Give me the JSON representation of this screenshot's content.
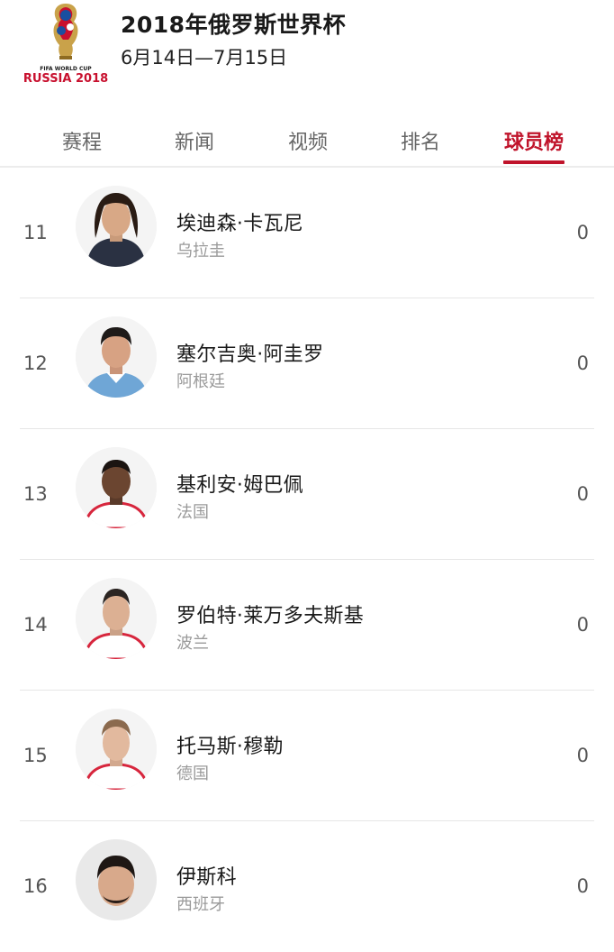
{
  "header": {
    "title": "2018年俄罗斯世界杯",
    "dates": "6月14日—7月15日",
    "logo_caption_top": "FIFA WORLD CUP",
    "logo_caption_bottom": "RUSSIA 2018"
  },
  "tabs": [
    {
      "label": "赛程",
      "active": false
    },
    {
      "label": "新闻",
      "active": false
    },
    {
      "label": "视频",
      "active": false
    },
    {
      "label": "排名",
      "active": false
    },
    {
      "label": "球员榜",
      "active": true
    }
  ],
  "players": [
    {
      "rank": "11",
      "name": "埃迪森·卡瓦尼",
      "country": "乌拉圭",
      "score": "0"
    },
    {
      "rank": "12",
      "name": "塞尔吉奥·阿圭罗",
      "country": "阿根廷",
      "score": "0"
    },
    {
      "rank": "13",
      "name": "基利安·姆巴佩",
      "country": "法国",
      "score": "0"
    },
    {
      "rank": "14",
      "name": "罗伯特·莱万多夫斯基",
      "country": "波兰",
      "score": "0"
    },
    {
      "rank": "15",
      "name": "托马斯·穆勒",
      "country": "德国",
      "score": "0"
    },
    {
      "rank": "16",
      "name": "伊斯科",
      "country": "西班牙",
      "score": "0"
    }
  ],
  "colors": {
    "accent": "#c0142b"
  }
}
